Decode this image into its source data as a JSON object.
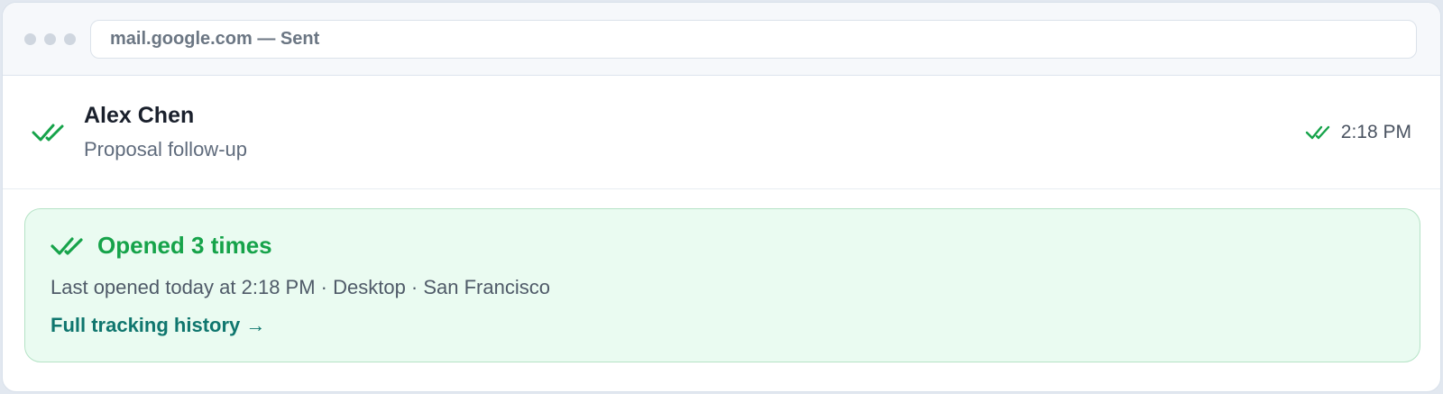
{
  "browser": {
    "url_text": "mail.google.com — Sent"
  },
  "email": {
    "sender": "Alex Chen",
    "subject": "Proposal follow-up",
    "time": "2:18 PM",
    "read_icon": "double-check-icon"
  },
  "tracking": {
    "status": "Opened 3 times",
    "detail": "Last opened today at 2:18 PM · Desktop · San Francisco",
    "link_label": "Full tracking history →",
    "icon": "double-check-icon"
  },
  "colors": {
    "accent_green": "#16a34a",
    "link_teal": "#0f766e",
    "panel_bg": "#eafbf1"
  }
}
